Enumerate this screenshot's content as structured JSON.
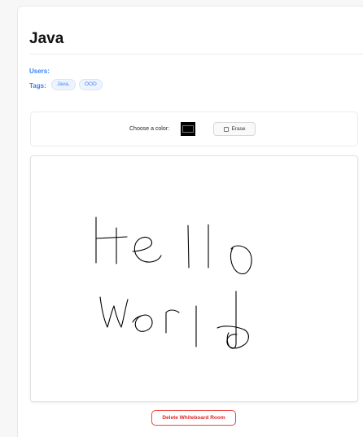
{
  "room": {
    "title": "Java",
    "users_label": "Users:",
    "tags_label": "Tags:",
    "tags": [
      "Java,",
      "OOD"
    ]
  },
  "toolbar": {
    "color_label": "Choose a color:",
    "selected_color": "#000000",
    "erase_label": "Erase",
    "erase_checked": false
  },
  "whiteboard": {
    "drawing_description_icon": "freehand-handwriting-drawing",
    "stroke_color": "#000000"
  },
  "actions": {
    "delete_label": "Delete Whiteboard Room"
  },
  "colors": {
    "accent": "#3b82f6",
    "danger": "#dc2626"
  }
}
